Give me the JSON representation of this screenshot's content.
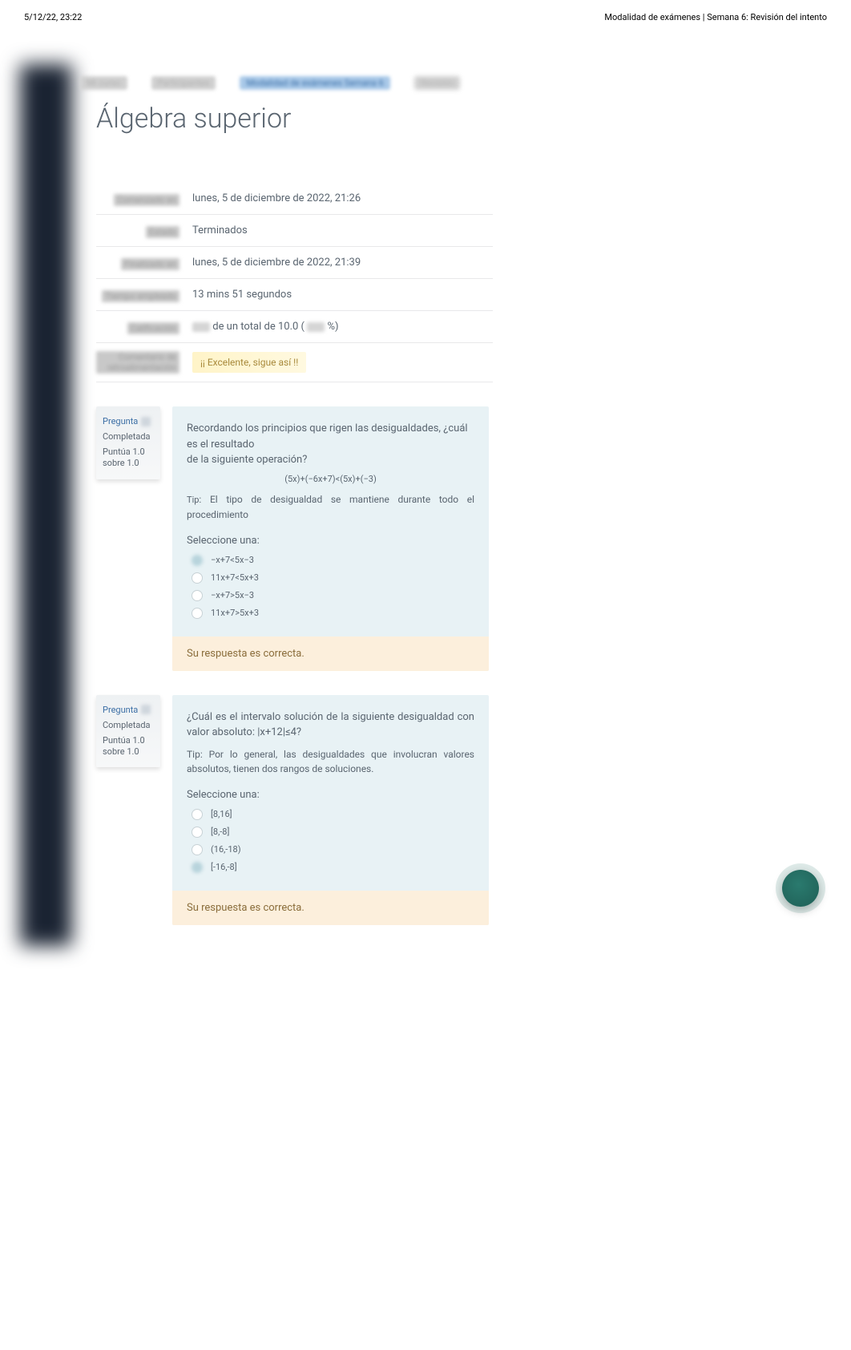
{
  "print_header": {
    "left": "5/12/22, 23:22",
    "right": "Modalidad de exámenes | Semana 6: Revisión del intento"
  },
  "breadcrumb": {
    "items": [
      "Mi curso",
      "Participantes",
      "Modalidad de exámenes Semana 6",
      "Revisión"
    ]
  },
  "page_title": "Álgebra superior",
  "summary": {
    "rows": [
      {
        "label": "Comenzado en",
        "value": "lunes, 5 de diciembre de 2022, 21:26"
      },
      {
        "label": "Estado",
        "value": "Terminados"
      },
      {
        "label": "Finalizado en",
        "value": "lunes, 5 de diciembre de 2022, 21:39"
      },
      {
        "label": "Tiempo empleado",
        "value": "13 mins 51 segundos"
      }
    ],
    "grade_label": "Calificación",
    "grade_mid": " de un total de 10.0 (",
    "grade_end": "%)",
    "feedback_label": "Comentario de retroalimentación",
    "feedback_text": "¡¡ Excelente, sigue así !!"
  },
  "questions": [
    {
      "label": "Pregunta",
      "state": "Completada",
      "grade": "Puntúa 1.0 sobre 1.0",
      "body_line1": "Recordando los principios que rigen las desigualdades, ¿cuál es el resultado",
      "body_line2": "de la siguiente operación?",
      "formula": "(5x)+(−6x+7)<(5x)+(−3)",
      "tip_label": "Tip",
      "tip_text": ": El tipo de desigualdad se mantiene durante todo el procedimiento",
      "select_label": "Seleccione una:",
      "options": [
        "−x+7<5x−3",
        "11x+7<5x+3",
        "−x+7>5x−3",
        "11x+7>5x+3"
      ],
      "selected": 0,
      "correct_msg": "Su respuesta es correcta."
    },
    {
      "label": "Pregunta",
      "state": "Completada",
      "grade": "Puntúa 1.0 sobre 1.0",
      "body_line1": "¿Cuál es el intervalo solución de la siguiente desigualdad con valor absoluto: |x+12|≤4?",
      "tip_full": "Tip: Por lo general, las desigualdades que involucran valores absolutos, tienen dos rangos de soluciones.",
      "select_label": "Seleccione una:",
      "options": [
        "[8,16]",
        "[8,-8]",
        "(16,-18)",
        "[-16,-8]"
      ],
      "selected": 3,
      "correct_msg": "Su respuesta es correcta."
    }
  ]
}
